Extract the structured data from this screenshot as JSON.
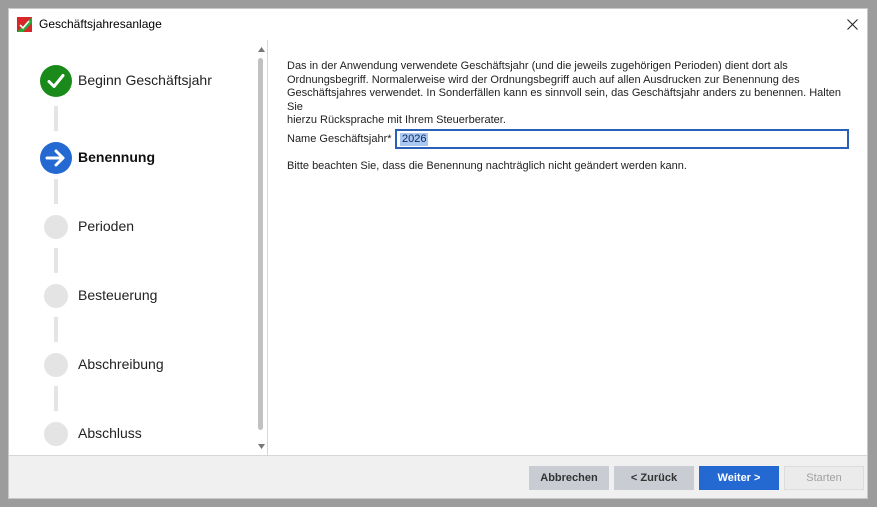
{
  "window": {
    "title": "Geschäftsjahresanlage"
  },
  "colors": {
    "done": "#1a8a1a",
    "active": "#2369d1",
    "pending": "#e4e4e4",
    "primary_button": "#2369d1"
  },
  "steps": [
    {
      "label": "Beginn Geschäftsjahr",
      "state": "done",
      "icon": "check-icon"
    },
    {
      "label": "Benennung",
      "state": "active",
      "icon": "arrow-right-icon"
    },
    {
      "label": "Perioden",
      "state": "pending"
    },
    {
      "label": "Besteuerung",
      "state": "pending"
    },
    {
      "label": "Abschreibung",
      "state": "pending"
    },
    {
      "label": "Abschluss",
      "state": "pending"
    }
  ],
  "content": {
    "description_lines": [
      "Das in der Anwendung verwendete Geschäftsjahr (und die jeweils zugehörigen Perioden) dient dort als",
      "Ordnungsbegriff. Normalerweise wird der Ordnungsbegriff auch auf allen Ausdrucken zur Benennung des",
      "Geschäftsjahres verwendet. In Sonderfällen kann es sinnvoll sein, das Geschäftsjahr anders zu benennen. Halten Sie",
      "hierzu Rücksprache mit Ihrem Steuerberater."
    ],
    "field_label": "Name Geschäftsjahr*",
    "field_value": "2026",
    "note": "Bitte beachten Sie, dass die Benennung nachträglich nicht geändert werden kann."
  },
  "footer": {
    "cancel": "Abbrechen",
    "back": "< Zurück",
    "next": "Weiter >",
    "start": "Starten"
  }
}
